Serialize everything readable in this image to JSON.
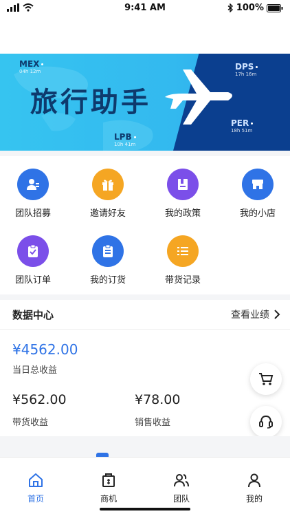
{
  "status_bar": {
    "time": "9:41 AM",
    "battery": "100%"
  },
  "banner": {
    "title": "旅行助手",
    "codes": [
      {
        "code": "MEX",
        "time": "04h 12m"
      },
      {
        "code": "DPS",
        "time": "17h 16m"
      },
      {
        "code": "LPB",
        "time": "10h 41m"
      },
      {
        "code": "PER",
        "time": "18h 51m"
      }
    ]
  },
  "grid": [
    {
      "label": "团队招募",
      "icon": "team-recruit-icon",
      "color": "#2f73e6"
    },
    {
      "label": "邀请好友",
      "icon": "gift-icon",
      "color": "#f5a623"
    },
    {
      "label": "我的政策",
      "icon": "policy-book-icon",
      "color": "#7b4fe9"
    },
    {
      "label": "我的小店",
      "icon": "store-icon",
      "color": "#2f73e6"
    },
    {
      "label": "团队订单",
      "icon": "clipboard-check-icon",
      "color": "#7b4fe9"
    },
    {
      "label": "我的订货",
      "icon": "order-list-icon",
      "color": "#2f73e6"
    },
    {
      "label": "带货记录",
      "icon": "list-icon",
      "color": "#f5a623"
    }
  ],
  "data_center": {
    "title": "数据中心",
    "link": "查看业绩",
    "total_value": "¥4562.00",
    "total_label": "当日总收益",
    "goods_value": "¥562.00",
    "goods_label": "带货收益",
    "sales_value": "¥78.00",
    "sales_label": "销售收益"
  },
  "tabs": [
    {
      "label": "首页",
      "icon": "home-icon",
      "active": true
    },
    {
      "label": "商机",
      "icon": "business-icon",
      "active": false
    },
    {
      "label": "团队",
      "icon": "team-icon",
      "active": false
    },
    {
      "label": "我的",
      "icon": "profile-icon",
      "active": false
    }
  ],
  "colors": {
    "accent": "#2f73e6",
    "orange": "#f5a623",
    "purple": "#7b4fe9"
  }
}
